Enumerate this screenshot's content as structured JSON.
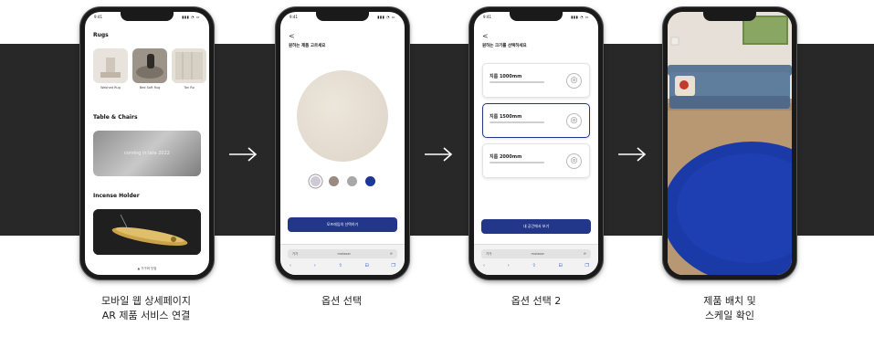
{
  "phones": [
    {
      "status_time": "9:41",
      "rugs_heading": "Rugs",
      "rugs": [
        {
          "label": "Washed Rug"
        },
        {
          "label": "Bed Soft Rug"
        },
        {
          "label": "Tan Ro"
        }
      ],
      "table_heading": "Table & Chairs",
      "table_banner": "coming in late 2022",
      "incense_heading": "Incense Holder",
      "footer": "▲ 가구와 닷컴"
    },
    {
      "status_time": "9:41",
      "back": "<",
      "title": "원하는 제품 고르세요",
      "swatch_colors": [
        "#cfc8d6",
        "#9a8a80",
        "#a8a8a8",
        "#1d3796"
      ],
      "cta": "모프레임의 선택하기",
      "url": "molaoar",
      "url_left": "가가",
      "url_right": "⟳"
    },
    {
      "status_time": "9:41",
      "back": "<",
      "title": "원하는 크기를 선택하세요",
      "options": [
        {
          "title": "지름 1000mm"
        },
        {
          "title": "지름 1500mm"
        },
        {
          "title": "지름 2000mm"
        }
      ],
      "cta": "내 공간에서 보기",
      "url": "molaoar",
      "url_left": "가가",
      "url_right": "⟳"
    },
    {
      "status_time": ""
    }
  ],
  "captions": [
    {
      "line1": "모바일 웹 상세페이지",
      "line2": "AR 제품 서비스 연결"
    },
    {
      "line1": "옵션 선택",
      "line2": ""
    },
    {
      "line1": "옵션 선택 2",
      "line2": ""
    },
    {
      "line1": "제품 배치 및",
      "line2": "스케일 확인"
    }
  ],
  "colors": {
    "band": "#282828",
    "accent": "#23378a",
    "rug_blue": "#1a3aa8"
  }
}
